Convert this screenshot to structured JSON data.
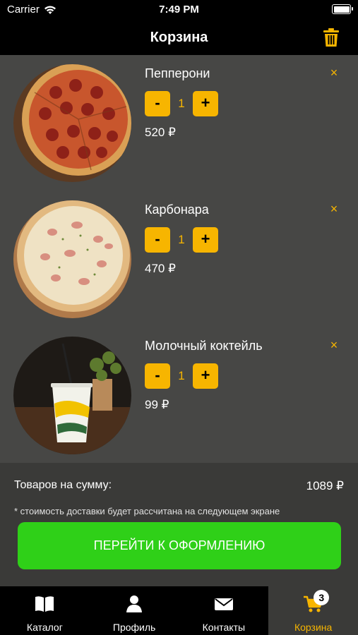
{
  "status_bar": {
    "carrier": "Carrier",
    "time": "7:49 PM"
  },
  "header": {
    "title": "Корзина"
  },
  "cart": {
    "items": [
      {
        "name": "Пепперони",
        "quantity": "1",
        "price": "520 ₽",
        "image": "pepperoni-pizza"
      },
      {
        "name": "Карбонара",
        "quantity": "1",
        "price": "470 ₽",
        "image": "carbonara-pizza"
      },
      {
        "name": "Молочный коктейль",
        "quantity": "1",
        "price": "99 ₽",
        "image": "milkshake"
      }
    ],
    "minus_label": "-",
    "plus_label": "+",
    "remove_label": "×"
  },
  "summary": {
    "total_label": "Товаров на сумму:",
    "total_value": "1089 ₽",
    "delivery_note": "* стоимость доставки будет рассчитана на следующем экране",
    "checkout_label": "ПЕРЕЙТИ К ОФОРМЛЕНИЮ"
  },
  "tabs": [
    {
      "label": "Каталог",
      "icon": "book-icon"
    },
    {
      "label": "Профиль",
      "icon": "person-icon"
    },
    {
      "label": "Контакты",
      "icon": "envelope-icon"
    },
    {
      "label": "Корзина",
      "icon": "cart-icon",
      "badge": "3",
      "active": true
    }
  ],
  "colors": {
    "accent": "#f7b500",
    "checkout": "#2fd018",
    "list_bg": "#474745",
    "summary_bg": "#3a3a38"
  }
}
